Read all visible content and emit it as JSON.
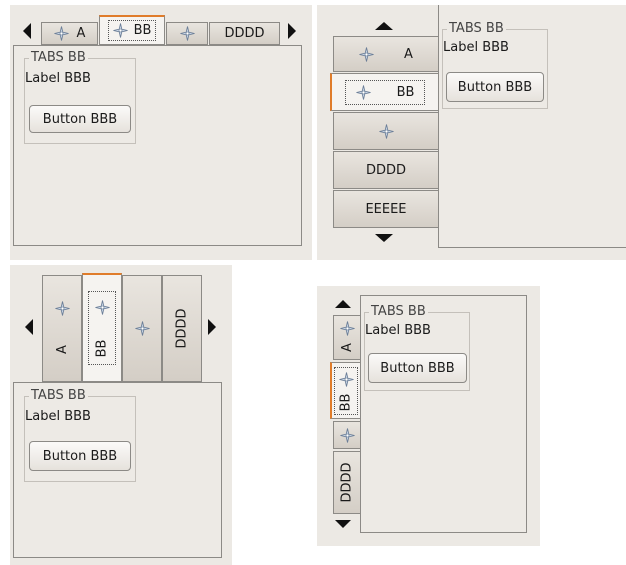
{
  "tabs": {
    "a": "A",
    "bb": "BB",
    "dddd": "DDDD",
    "eeeee": "EEEEE"
  },
  "page": {
    "frame_title": "TABS BB",
    "label": "Label BBB",
    "button": "Button BBB"
  },
  "icons": {
    "tab_icon": "plus-cross-icon",
    "scroll_left": "triangle-left-icon",
    "scroll_right": "triangle-right-icon",
    "scroll_up": "triangle-up-icon",
    "scroll_down": "triangle-down-icon"
  },
  "colors": {
    "active_tab_accent": "#e07c2a",
    "background": "#ece9e4"
  }
}
